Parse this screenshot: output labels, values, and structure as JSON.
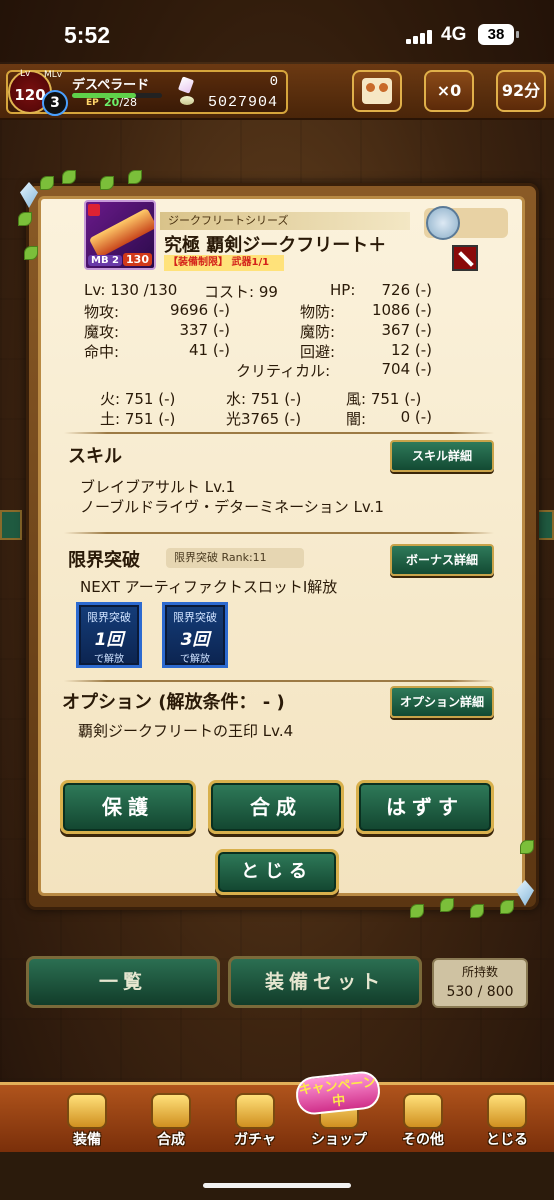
{
  "status_bar": {
    "time": "5:52",
    "network": "4G",
    "battery": "38"
  },
  "hud": {
    "lv_tag": "Lv",
    "level": "120",
    "mlv_tag": "MLv",
    "master_level": "3",
    "player_name": "デスペラード",
    "ep_label": "EP",
    "ep_current": "20",
    "ep_max": "/28",
    "ep_fraction": 0.71,
    "gems": "0",
    "gold": "5027904",
    "gift_count": "×0",
    "time_left": "92分"
  },
  "item": {
    "series": "ジークフリートシリーズ",
    "name": "究極 覇剣ジークフリート＋",
    "restriction": "【装備制限】 武器1/1",
    "mb": "MB 2",
    "icon_level": "130"
  },
  "stats": {
    "lv_label": "Lv: 130 /130",
    "cost_label": "コスト: 99",
    "hp_label": "HP:",
    "hp_val": "726 (-)",
    "patk_label": "物攻:",
    "patk_val": "9696 (-)",
    "pdef_label": "物防:",
    "pdef_val": "1086 (-)",
    "matk_label": "魔攻:",
    "matk_val": "337 (-)",
    "mdef_label": "魔防:",
    "mdef_val": "367 (-)",
    "hit_label": "命中:",
    "hit_val": "41 (-)",
    "eva_label": "回避:",
    "eva_val": "12 (-)",
    "crit_label": "クリティカル:",
    "crit_val": "704 (-)",
    "fire": "火: 751 (-)",
    "water": "水: 751 (-)",
    "wind": "風: 751 (-)",
    "earth": "土: 751 (-)",
    "light": "光3765 (-)",
    "dark_label": "闇:",
    "dark_val": "0 (-)"
  },
  "skill": {
    "title": "スキル",
    "detail_button": "スキル詳細",
    "lines": [
      "ブレイブアサルト  Lv.1",
      "ノーブルドライヴ・デターミネーション  Lv.1"
    ]
  },
  "limit_break": {
    "title": "限界突破",
    "rank": "限界突破 Rank:11",
    "detail_button": "ボーナス詳細",
    "next": "NEXT アーティファクトスロットⅠ解放",
    "boxes": [
      {
        "top": "限界突破",
        "count": "1回",
        "bottom": "で解放"
      },
      {
        "top": "限界突破",
        "count": "3回",
        "bottom": "で解放"
      }
    ]
  },
  "option": {
    "title": "オプション (解放条件： - )",
    "detail_button": "オプション詳細",
    "line": "覇剣ジークフリートの王印 Lv.4"
  },
  "actions": {
    "protect": "保護",
    "synth": "合成",
    "remove": "はずす",
    "close": "とじる"
  },
  "lower": {
    "list": "一覧",
    "equip_set": "装備セット",
    "owned_label": "所持数",
    "owned_value": "530 / 800"
  },
  "nav": {
    "campaign": "キャンペーン中",
    "items": [
      "装備",
      "合成",
      "ガチャ",
      "ショップ",
      "その他",
      "とじる"
    ]
  }
}
